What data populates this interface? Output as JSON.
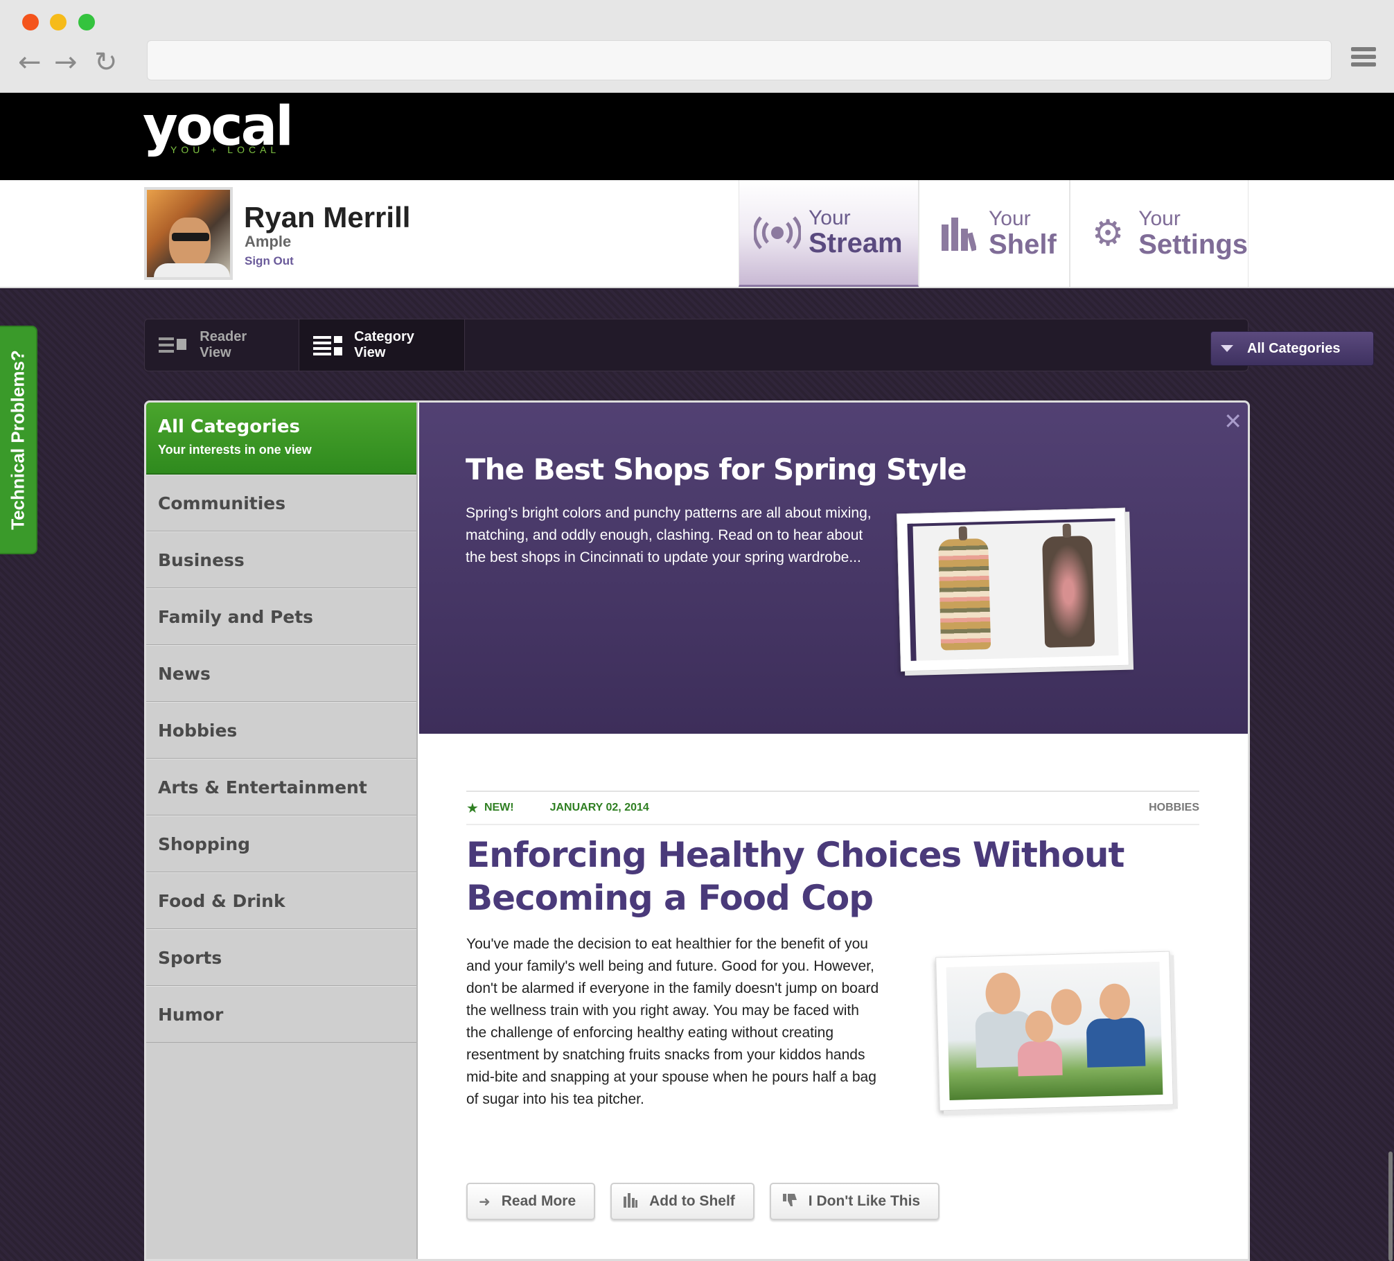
{
  "browser": {
    "back_icon": "arrow-left-icon",
    "forward_icon": "arrow-right-icon",
    "reload_icon": "reload-icon",
    "menu_icon": "hamburger-menu-icon",
    "url": ""
  },
  "site": {
    "logo_text": "yocal",
    "logo_tagline": "YOU + LOCAL"
  },
  "user": {
    "name": "Ryan Merrill",
    "company": "Ample",
    "sign_out": "Sign Out"
  },
  "tabs": [
    {
      "small": "Your",
      "big": "Stream",
      "icon": "broadcast-icon",
      "active": true
    },
    {
      "small": "Your",
      "big": "Shelf",
      "icon": "books-icon",
      "active": false
    },
    {
      "small": "Your",
      "big": "Settings",
      "icon": "gear-icon",
      "active": false
    }
  ],
  "side_tab": {
    "label": "Technical Problems?"
  },
  "view_toolbar": {
    "reader_label": "Reader View",
    "category_label": "Category View",
    "dropdown_label": "All Categories"
  },
  "sidebar": {
    "title": "All Categories",
    "subtitle": "Your interests in one view",
    "items": [
      {
        "label": "Communities"
      },
      {
        "label": "Business"
      },
      {
        "label": "Family and Pets"
      },
      {
        "label": "News"
      },
      {
        "label": "Hobbies"
      },
      {
        "label": "Arts & Entertainment"
      },
      {
        "label": "Shopping"
      },
      {
        "label": "Food & Drink"
      },
      {
        "label": "Sports"
      },
      {
        "label": "Humor"
      }
    ]
  },
  "hero": {
    "title": "The Best Shops for Spring Style",
    "text": "Spring’s bright colors and punchy patterns are all about mixing, matching, and oddly enough, clashing. Read on to hear about the best shops in Cincinnati to update your spring wardrobe...",
    "close": "✕"
  },
  "article": {
    "new_label": "NEW!",
    "date": "JANUARY 02, 2014",
    "category": "HOBBIES",
    "title": "Enforcing Healthy Choices Without Becoming a Food Cop",
    "body": "You've made the decision to eat healthier for the benefit of you and your family's well being and future. Good for you. However, don't be alarmed if everyone in the family doesn't jump on board the wellness train with you right away. You may be faced with the challenge of enforcing healthy eating without creating resentment by snatching fruits snacks from your kiddos hands mid-bite and snapping at your spouse when he pours half a bag of sugar into his tea pitcher.",
    "buttons": {
      "read_more": "Read More",
      "add_to_shelf": "Add to Shelf",
      "dislike": "I Don't Like This"
    }
  },
  "colors": {
    "accent_purple": "#4a3a7a",
    "accent_green": "#3a9a2a",
    "header_black": "#000000"
  }
}
